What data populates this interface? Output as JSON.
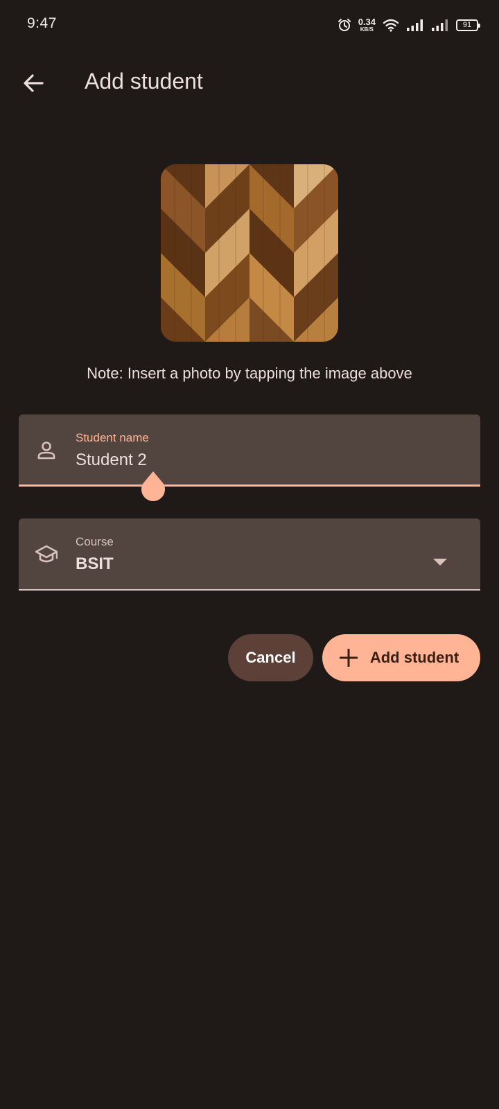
{
  "status_bar": {
    "time": "9:47",
    "net_speed_value": "0.34",
    "net_speed_unit": "KB/S",
    "battery": "91",
    "icons": [
      "alarm-icon",
      "wifi-icon",
      "signal-icon",
      "signal-icon",
      "battery-icon"
    ]
  },
  "app_bar": {
    "title": "Add student",
    "back_icon": "arrow-back-icon"
  },
  "photo": {
    "icon": "wood-pattern-image",
    "note": "Note: Insert a photo by tapping the image above"
  },
  "form": {
    "name_field": {
      "label": "Student name",
      "value": "Student 2",
      "icon": "person-icon"
    },
    "course_field": {
      "label": "Course",
      "value": "BSIT",
      "icon": "school-icon",
      "trailing_icon": "dropdown-arrow-icon"
    }
  },
  "actions": {
    "cancel_label": "Cancel",
    "add_label": "Add student",
    "add_icon": "plus-icon"
  },
  "colors": {
    "background": "#1f1a17",
    "field_bg": "#524540",
    "accent": "#ffb595",
    "cancel_bg": "#5d4037"
  }
}
